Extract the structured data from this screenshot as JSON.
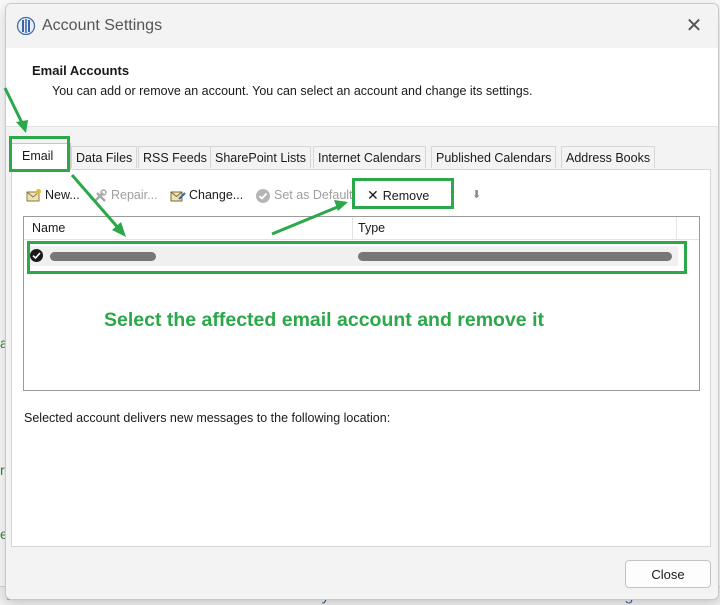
{
  "window": {
    "title": "Account Settings",
    "close_glyph": "✕"
  },
  "header": {
    "title": "Email Accounts",
    "description": "You can add or remove an account. You can select an account and change its settings."
  },
  "tabs": [
    {
      "label": "Email",
      "active": true
    },
    {
      "label": "Data Files"
    },
    {
      "label": "RSS Feeds"
    },
    {
      "label": "SharePoint Lists"
    },
    {
      "label": "Internet Calendars"
    },
    {
      "label": "Published Calendars"
    },
    {
      "label": "Address Books"
    }
  ],
  "toolbar": {
    "new_label": "New...",
    "repair_label": "Repair...",
    "change_label": "Change...",
    "set_default_label": "Set as Default",
    "remove_label": "Remove",
    "remove_glyph": "✕",
    "up_glyph": "⬆",
    "down_glyph": "⬇"
  },
  "accounts_table": {
    "columns": [
      "Name",
      "Type"
    ],
    "rows": [
      {
        "name": "",
        "type": "",
        "default": true,
        "redacted": true
      }
    ]
  },
  "deliver_text": "Selected account delivers new messages to the following location:",
  "footer": {
    "close_label": "Close"
  },
  "annotation": {
    "text": "Select the affected email account and remove it",
    "color": "#2ba84a"
  },
  "background_app": {
    "fragments": [
      "ans and Features",
      "Recovery",
      "Region"
    ]
  }
}
